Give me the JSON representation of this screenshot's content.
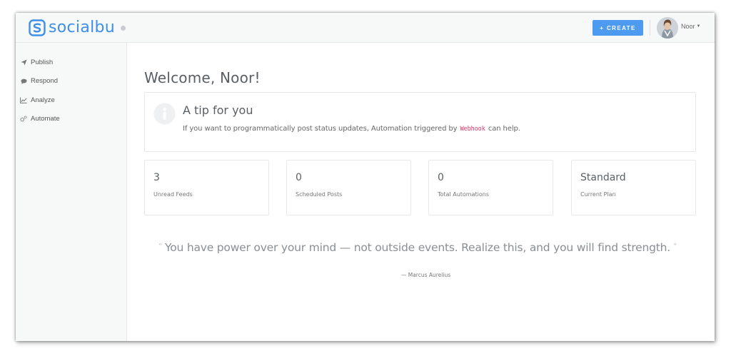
{
  "brand": {
    "name": "socialbu",
    "color": "#3d8fe8"
  },
  "header": {
    "create_label": "+ CREATE",
    "create_color": "#4c9bf0",
    "user_name": "Noor",
    "avatar_icon": "user-avatar-photo"
  },
  "sidebar": {
    "items": [
      {
        "label": "Publish",
        "icon": "paper-plane-icon"
      },
      {
        "label": "Respond",
        "icon": "chat-bubble-icon"
      },
      {
        "label": "Analyze",
        "icon": "line-chart-icon"
      },
      {
        "label": "Automate",
        "icon": "gears-icon"
      }
    ]
  },
  "main": {
    "welcome": "Welcome, Noor!",
    "tip": {
      "title": "A tip for you",
      "text_before": "If you want to programmatically post status updates, Automation triggered by",
      "code": "Webhook",
      "text_after": "can help.",
      "icon": "info-icon"
    },
    "stats": [
      {
        "value": "3",
        "label": "Unread Feeds"
      },
      {
        "value": "0",
        "label": "Scheduled Posts"
      },
      {
        "value": "0",
        "label": "Total Automations"
      },
      {
        "value": "Standard",
        "label": "Current Plan"
      }
    ],
    "quote": {
      "open_mark": "“",
      "text": "You have power over your mind — not outside events. Realize this, and you will find strength.",
      "close_mark": "”",
      "author": "—  Marcus Aurelius"
    }
  }
}
